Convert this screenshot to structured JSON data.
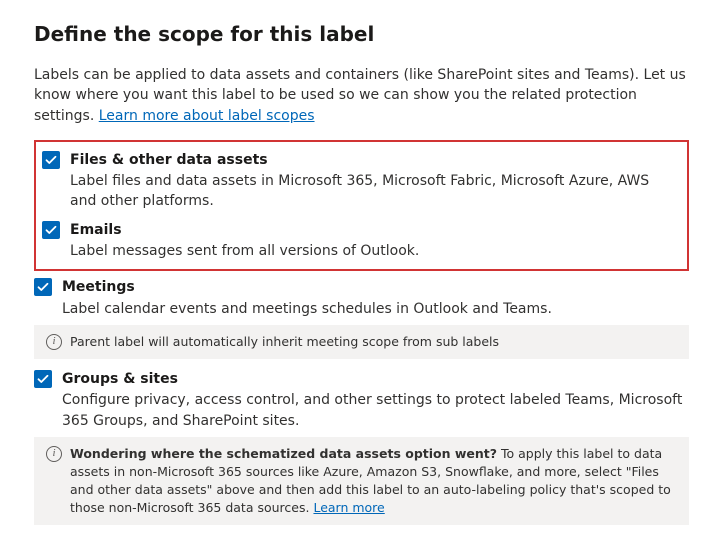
{
  "heading": "Define the scope for this label",
  "intro_text": "Labels can be applied to data assets and containers (like SharePoint sites and Teams). Let us know where you want this label to be used so we can show you the related protection settings. ",
  "intro_link": "Learn more about label scopes",
  "options": {
    "files": {
      "title": "Files & other data assets",
      "desc": "Label files and data assets in Microsoft 365, Microsoft Fabric, Microsoft Azure, AWS and other platforms."
    },
    "emails": {
      "title": "Emails",
      "desc": "Label messages sent from all versions of Outlook."
    },
    "meetings": {
      "title": "Meetings",
      "desc": "Label calendar events and meetings schedules in Outlook and Teams."
    },
    "groups": {
      "title": "Groups & sites",
      "desc": "Configure privacy, access control, and other settings to protect labeled Teams, Microsoft 365 Groups, and SharePoint sites."
    }
  },
  "info_meetings": "Parent label will automatically inherit meeting scope from sub labels",
  "info_schematized": {
    "bold": "Wondering where the schematized data assets option went?",
    "rest": " To apply this label to data assets in non-Microsoft 365 sources like Azure, Amazon S3, Snowflake, and more, select \"Files and other data assets\" above and then add this label to an auto-labeling policy that's scoped to those non-Microsoft 365 data sources. ",
    "link": "Learn more"
  }
}
